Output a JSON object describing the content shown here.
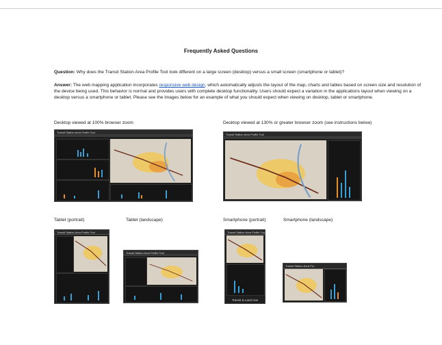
{
  "page": {
    "title": "Frequently Asked Questions",
    "question_label": "Question:",
    "question_text": "Why does the Transit Station Area Profile Tool look different on a large screen (desktop) versus a small screen (smartphone or tablet)?",
    "answer_label": "Answer:",
    "answer_pre": "The web mapping application incorporates",
    "answer_link": "responsive web design",
    "answer_post": ", which automatically adjusts the layout of the map, charts and tables based on screen size and resolution of the device being used.  This behavior is normal and provides users with complete desktop functionality.  Users should expect a variation in the applications layout when viewing on a desktop versus a smartphone or tablet.  Please see the images below for an example of what you should expect when viewing on desktop, tablet or smartphone."
  },
  "captions": {
    "desktop_100": "Desktop viewed at 100% browser zoom",
    "desktop_130": "Desktop viewed at 130% or greater browser zoom (see instructions below)",
    "tablet_portrait": "Tablet (portrait)",
    "tablet_landscape": "Tablet (landscape)",
    "phone_portrait": "Smartphone (portrait)",
    "phone_landscape": "Smartphone (landscape)"
  },
  "screenshots": {
    "app_title": "Transit Station Area Profile Tool",
    "app_title_short": "Transit Station Area Pro",
    "footer_label": "Transit & Land Use"
  },
  "colors": {
    "app_bg": "#1f1f1f",
    "bar_blue": "#3aa0d8",
    "bar_orange": "#e8902a",
    "map_bg": "#d9d2c4",
    "density_yellow": "#f3c64a",
    "link": "#1a55b8"
  }
}
